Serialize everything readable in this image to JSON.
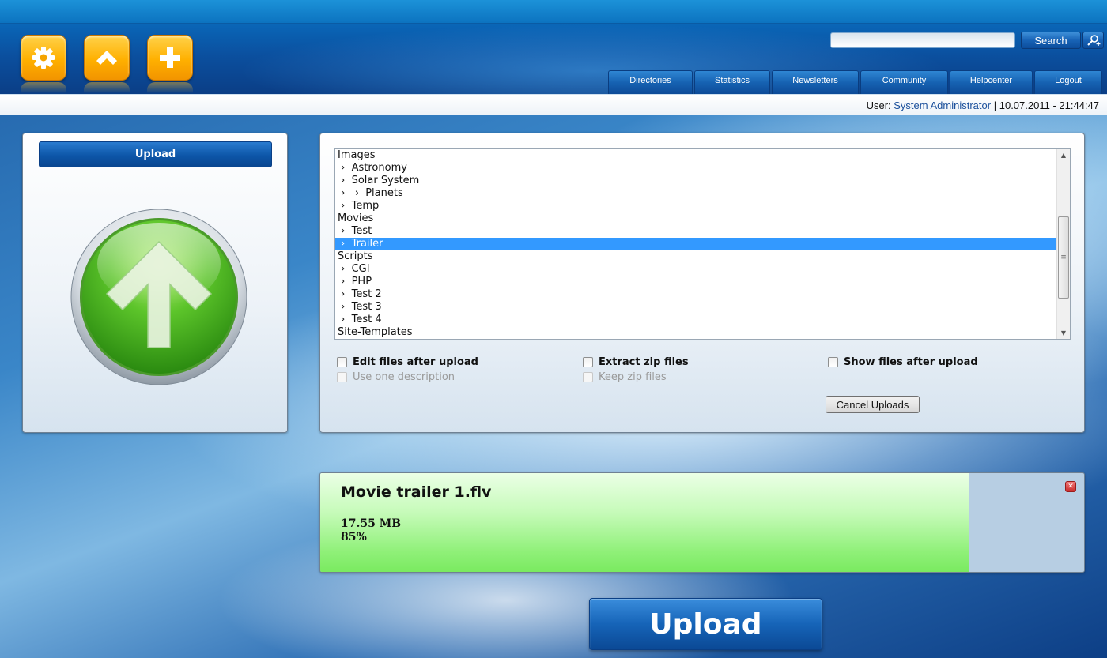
{
  "header": {
    "app_buttons": [
      {
        "name": "settings",
        "icon": "gear-icon"
      },
      {
        "name": "home",
        "icon": "home-icon"
      },
      {
        "name": "add",
        "icon": "plus-icon"
      }
    ],
    "search": {
      "placeholder": "",
      "button_label": "Search",
      "advanced_icon": "advanced-search-icon"
    },
    "nav_tabs": [
      {
        "label": "Directories"
      },
      {
        "label": "Statistics"
      },
      {
        "label": "Newsletters"
      },
      {
        "label": "Community"
      },
      {
        "label": "Helpcenter"
      },
      {
        "label": "Logout"
      }
    ]
  },
  "status": {
    "user_prefix": "User:",
    "user_name": "System Administrator",
    "separator": "|",
    "datetime": "10.07.2011 - 21:44:47"
  },
  "left_panel": {
    "title": "Upload",
    "upload_icon": "upload-arrow-icon"
  },
  "directories": {
    "items": [
      {
        "label": "Images",
        "level": 0
      },
      {
        "label": " ›  Astronomy",
        "level": 1
      },
      {
        "label": " ›  Solar System",
        "level": 1
      },
      {
        "label": " ›   ›  Planets",
        "level": 2
      },
      {
        "label": " ›  Temp",
        "level": 1
      },
      {
        "label": "Movies",
        "level": 0
      },
      {
        "label": " ›  Test",
        "level": 1
      },
      {
        "label": " ›  Trailer",
        "level": 1,
        "selected": true
      },
      {
        "label": "Scripts",
        "level": 0
      },
      {
        "label": " ›  CGI",
        "level": 1
      },
      {
        "label": " ›  PHP",
        "level": 1
      },
      {
        "label": " ›  Test 2",
        "level": 1
      },
      {
        "label": " ›  Test 3",
        "level": 1
      },
      {
        "label": " ›  Test 4",
        "level": 1
      },
      {
        "label": "Site-Templates",
        "level": 0
      }
    ]
  },
  "options": {
    "edit_files": {
      "label": "Edit files after upload",
      "checked": false
    },
    "one_description": {
      "label": "Use one description",
      "checked": false,
      "disabled": true
    },
    "extract_zip": {
      "label": "Extract zip files",
      "checked": false
    },
    "keep_zip": {
      "label": "Keep zip files",
      "checked": false,
      "disabled": true
    },
    "show_files": {
      "label": "Show files after upload",
      "checked": false
    },
    "cancel_label": "Cancel Uploads"
  },
  "upload_item": {
    "file_name": "Movie trailer 1.flv",
    "size": "17.55 MB",
    "percent_label": "85%",
    "progress": 0.85,
    "remove_icon": "close-icon"
  },
  "upload_button_label": "Upload",
  "colors": {
    "accent": "#0d56a8",
    "selected_row": "#3399ff",
    "progress_fill": "#8ff078",
    "app_button": "#ffb000"
  }
}
